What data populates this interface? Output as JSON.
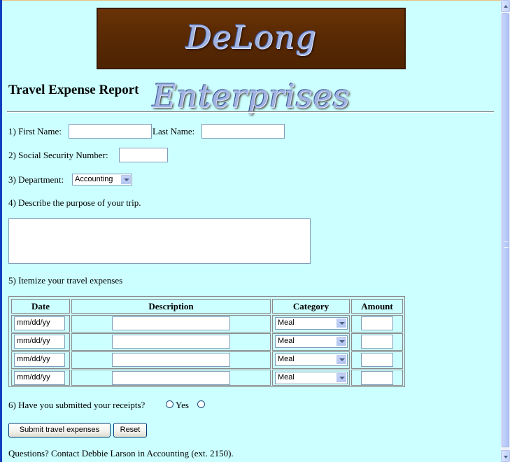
{
  "banner": {
    "text": "DeLong Enterprises"
  },
  "title": "Travel Expense Report",
  "q1": {
    "first_label": "1) First Name:",
    "last_label": "Last Name:",
    "first_value": "",
    "last_value": ""
  },
  "q2": {
    "label": "2) Social Security Number:",
    "value": ""
  },
  "q3": {
    "label": "3) Department:",
    "selected": "Accounting"
  },
  "q4": {
    "label": "4) Describe the purpose of your trip.",
    "value": ""
  },
  "q5": {
    "label": "5) Itemize your travel expenses",
    "headers": {
      "date": "Date",
      "description": "Description",
      "category": "Category",
      "amount": "Amount"
    },
    "rows": [
      {
        "date": "mm/dd/yy",
        "description": "",
        "category": "Meal",
        "amount": ""
      },
      {
        "date": "mm/dd/yy",
        "description": "",
        "category": "Meal",
        "amount": ""
      },
      {
        "date": "mm/dd/yy",
        "description": "",
        "category": "Meal",
        "amount": ""
      },
      {
        "date": "mm/dd/yy",
        "description": "",
        "category": "Meal",
        "amount": ""
      }
    ]
  },
  "q6": {
    "label": "6) Have you submitted your receipts?",
    "yes_label": "Yes",
    "no_label": ""
  },
  "buttons": {
    "submit": "Submit travel expenses",
    "reset": "Reset"
  },
  "footer": "Questions? Contact Debbie Larson in Accounting (ext. 2150).",
  "colors": {
    "page_bg": "#ccffff",
    "banner_bg": "#5a2a04",
    "banner_text": "#9fb2e0"
  }
}
